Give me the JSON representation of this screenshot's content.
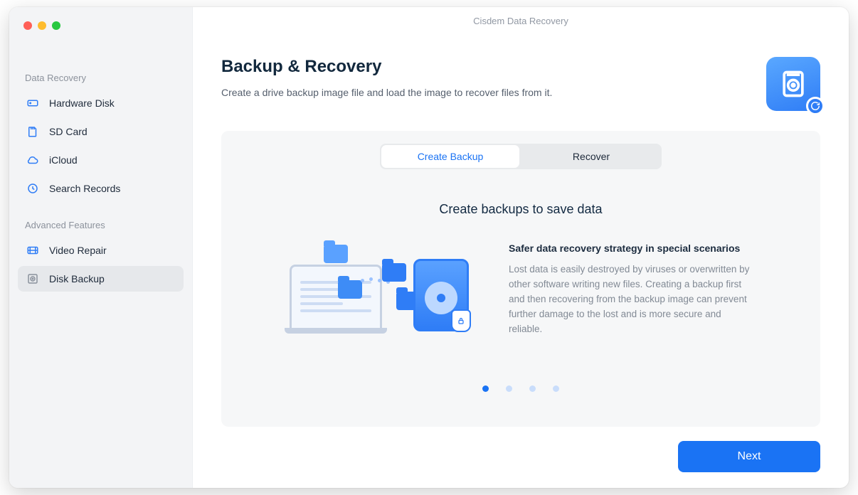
{
  "window": {
    "title": "Cisdem Data Recovery"
  },
  "sidebar": {
    "sections": [
      {
        "label": "Data Recovery",
        "items": [
          {
            "label": "Hardware Disk",
            "icon": "hard-drive-icon",
            "active": false
          },
          {
            "label": "SD Card",
            "icon": "sd-card-icon",
            "active": false
          },
          {
            "label": "iCloud",
            "icon": "cloud-icon",
            "active": false
          },
          {
            "label": "Search Records",
            "icon": "clock-icon",
            "active": false
          }
        ]
      },
      {
        "label": "Advanced Features",
        "items": [
          {
            "label": "Video Repair",
            "icon": "video-icon",
            "active": false
          },
          {
            "label": "Disk Backup",
            "icon": "disk-backup-icon",
            "active": true
          }
        ]
      }
    ]
  },
  "page": {
    "title": "Backup & Recovery",
    "subtitle": "Create a drive backup image file and load the image to recover files from it."
  },
  "tabs": {
    "create": "Create Backup",
    "recover": "Recover",
    "active": "create"
  },
  "panel": {
    "heading": "Create backups to save data",
    "info_title": "Safer data recovery strategy in special scenarios",
    "info_body": "Lost data is easily destroyed by viruses or overwritten by other software writing new files. Creating a backup first and then recovering from the backup image can prevent further damage to the lost and is more secure and reliable.",
    "pager": {
      "count": 4,
      "active_index": 0
    }
  },
  "footer": {
    "next_label": "Next"
  }
}
